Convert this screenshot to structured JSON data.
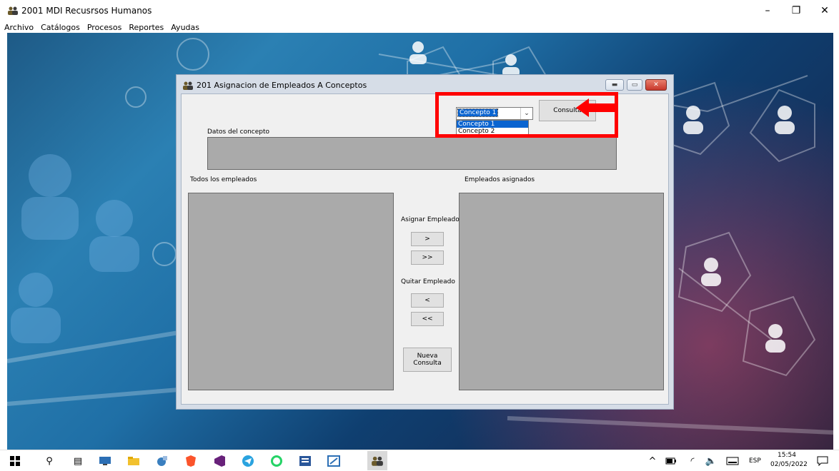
{
  "app": {
    "title": "2001 MDI Recusrsos Humanos",
    "minimize": "–",
    "maximize": "❐",
    "close": "✕"
  },
  "menu": [
    "Archivo",
    "Catálogos",
    "Procesos",
    "Reportes",
    "Ayudas"
  ],
  "child": {
    "title": "201 Asignacion de Empleados A Conceptos",
    "concept_combo": {
      "selected": "Concepto 1",
      "options": [
        "Concepto 1",
        "Concepto 2"
      ]
    },
    "consulta_label": "Consulta",
    "datos_label": "Datos del concepto",
    "todos_label": "Todos los empleados",
    "asignados_label": "Empleados asignados",
    "asignar_label": "Asignar Empleado",
    "btn_assign_one": ">",
    "btn_assign_all": ">>",
    "quitar_label": "Quitar Empleado",
    "btn_remove_one": "<",
    "btn_remove_all": "<<",
    "nueva_consulta_line1": "Nueva",
    "nueva_consulta_line2": "Consulta"
  },
  "taskbar": {
    "lang": "ESP",
    "time": "15:54",
    "date": "02/05/2022"
  },
  "colors": {
    "highlight": "#ff0000",
    "list_background": "#aaaaaa",
    "selection": "#0a64d0"
  }
}
